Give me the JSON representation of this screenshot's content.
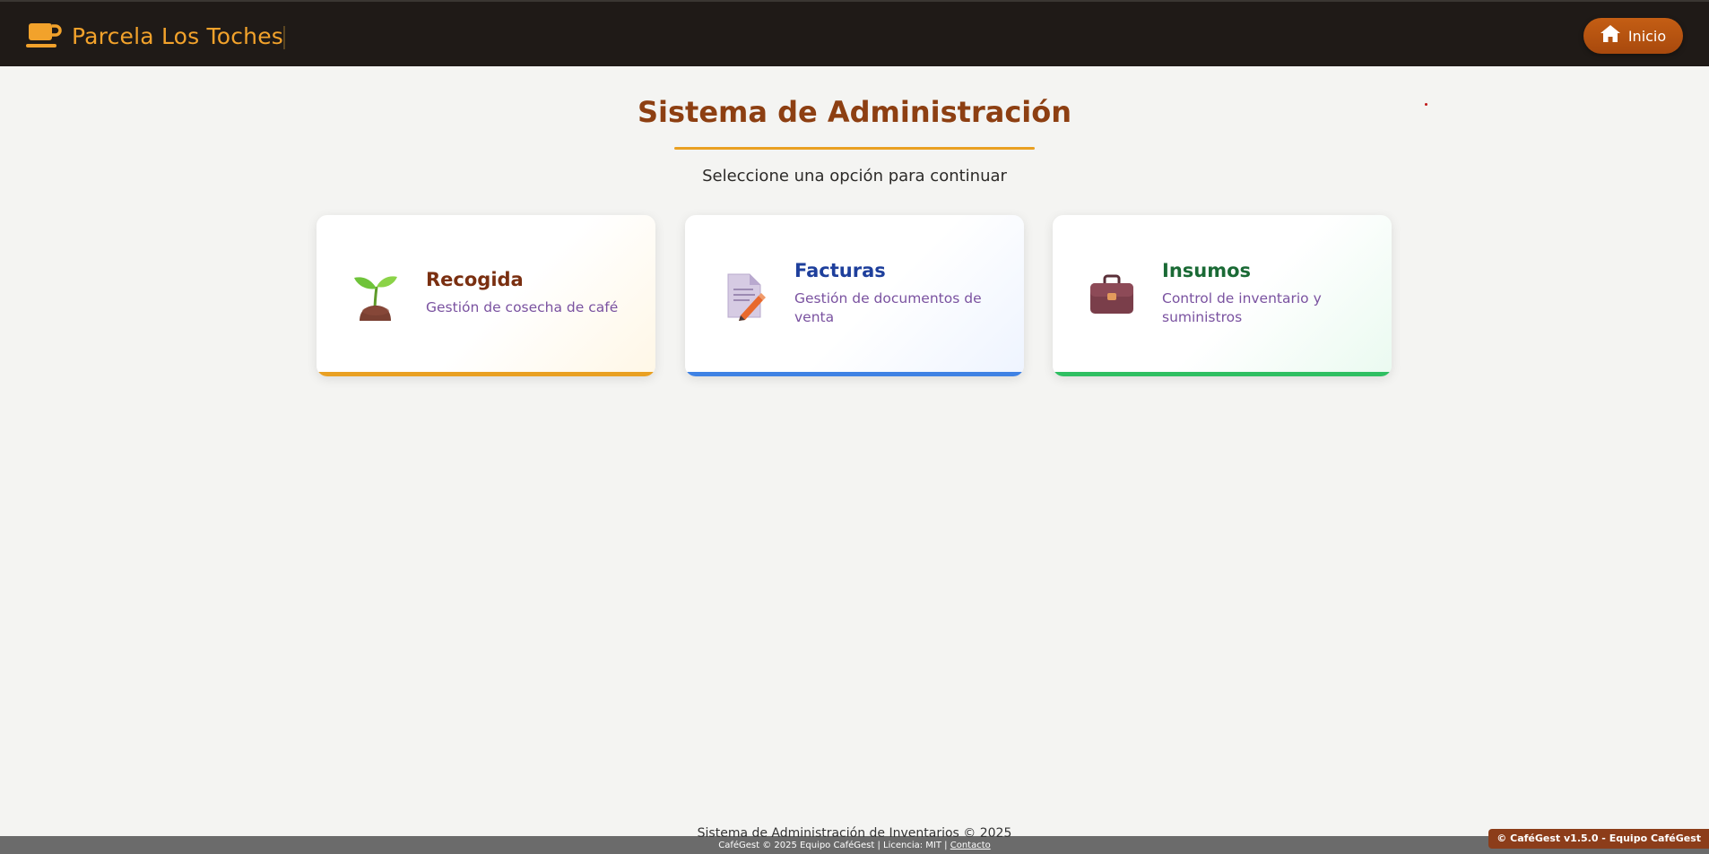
{
  "header": {
    "brand_name": "Parcela Los Toches",
    "brand_icon": "coffee-cup-icon",
    "home_button_label": "Inicio",
    "home_icon": "home-icon"
  },
  "main": {
    "title": "Sistema de Administración",
    "subtitle": "Seleccione una opción para continuar",
    "cards": [
      {
        "title": "Recogida",
        "description": "Gestión de cosecha de café",
        "icon": "sprout-icon",
        "accent": "#e9a022"
      },
      {
        "title": "Facturas",
        "description": "Gestión de documentos de venta",
        "icon": "document-pencil-icon",
        "accent": "#3f82e4"
      },
      {
        "title": "Insumos",
        "description": "Control de inventario y suministros",
        "icon": "briefcase-icon",
        "accent": "#2fbf62"
      }
    ]
  },
  "footer": {
    "text": "Sistema de Administración de Inventarios © 2025",
    "small_text": "CaféGest © 2025 Equipo CaféGest | Licencia: MIT |",
    "contact_link": "Contacto",
    "version_badge": "© CaféGest v1.5.0 - Equipo CaféGest"
  },
  "colors": {
    "topbar_bg": "#1f1a17",
    "brand": "#f2a22b",
    "title": "#8d3f12",
    "button": "#b8530f"
  }
}
